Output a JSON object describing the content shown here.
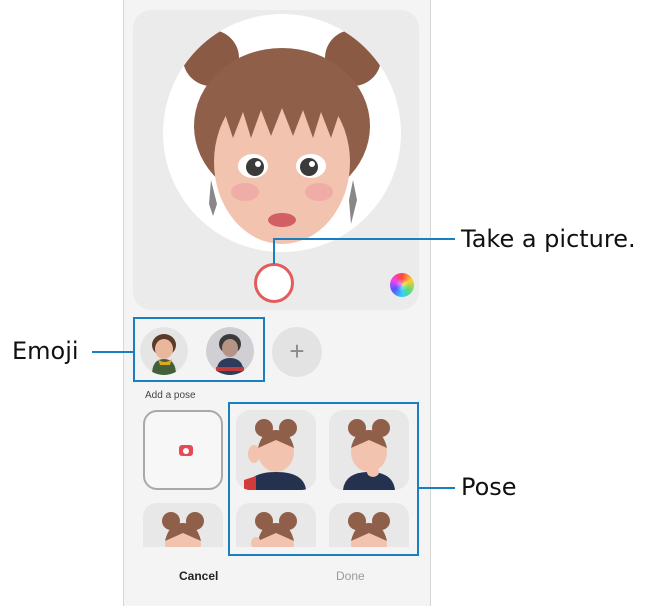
{
  "callouts": {
    "take_picture": "Take a picture.",
    "emoji": "Emoji",
    "pose": "Pose"
  },
  "section": {
    "add_pose_label": "Add a pose"
  },
  "buttons": {
    "add_emoji": "+",
    "cancel": "Cancel",
    "done": "Done"
  },
  "colors": {
    "shutter_ring": "#e35c5c",
    "callout": "#1a7fc1",
    "camera_icon": "#e84a55",
    "disabled_text": "#9a9a9a"
  },
  "icons": [
    "shutter-button-icon",
    "color-palette-icon",
    "plus-icon",
    "camera-icon"
  ]
}
